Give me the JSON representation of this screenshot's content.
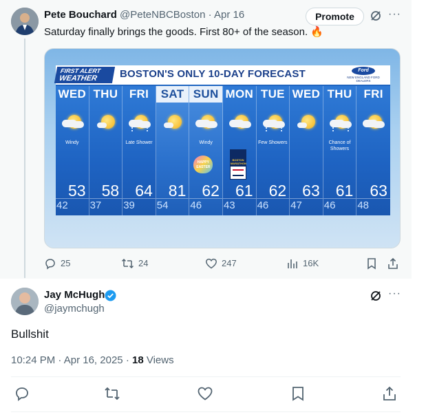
{
  "tweet1": {
    "name": "Pete Bouchard",
    "handle": "@PeteNBCBoston",
    "separator": "·",
    "date": "Apr 16",
    "promote_label": "Promote",
    "text": "Saturday finally brings the goods. First 80+ of the season.",
    "emoji": "🔥",
    "stats": {
      "replies": "25",
      "reposts": "24",
      "likes": "247",
      "views": "16K"
    }
  },
  "forecast": {
    "logo_line1": "FIRST ALERT",
    "logo_line2": "WEATHER",
    "title": "BOSTON'S ONLY 10-DAY FORECAST",
    "sponsor_logo": "Ford",
    "sponsor_text": "NEW ENGLAND FORD DEALERS",
    "days": [
      {
        "name": "WED",
        "icon": "partly-cloudy-icon",
        "condition": "Windy",
        "high": "53",
        "low": "42",
        "weekend": false
      },
      {
        "name": "THU",
        "icon": "mostly-sunny-icon",
        "condition": "",
        "high": "58",
        "low": "37",
        "weekend": false
      },
      {
        "name": "FRI",
        "icon": "showers-icon",
        "condition": "Late Shower",
        "high": "64",
        "low": "39",
        "weekend": false
      },
      {
        "name": "SAT",
        "icon": "mostly-sunny-icon",
        "condition": "",
        "high": "81",
        "low": "54",
        "weekend": true
      },
      {
        "name": "SUN",
        "icon": "partly-cloudy-icon",
        "condition": "Windy",
        "high": "62",
        "low": "46",
        "weekend": true
      },
      {
        "name": "MON",
        "icon": "partly-cloudy-icon",
        "condition": "",
        "high": "61",
        "low": "43",
        "weekend": false
      },
      {
        "name": "TUE",
        "icon": "showers-icon",
        "condition": "Few Showers",
        "high": "62",
        "low": "46",
        "weekend": false
      },
      {
        "name": "WED",
        "icon": "mostly-sunny-icon",
        "condition": "",
        "high": "63",
        "low": "47",
        "weekend": false
      },
      {
        "name": "THU",
        "icon": "showers-icon",
        "condition": "Chance of Showers",
        "high": "61",
        "low": "46",
        "weekend": false
      },
      {
        "name": "FRI",
        "icon": "partly-cloudy-icon",
        "condition": "",
        "high": "63",
        "low": "48",
        "weekend": false
      }
    ],
    "easter_badge": "HAPPY EASTER",
    "marathon_badge": "BOSTON MARATHON"
  },
  "tweet2": {
    "name": "Jay McHugh",
    "handle": "@jaymchugh",
    "text": "Bullshit",
    "time": "10:24 PM",
    "separator": "·",
    "date": "Apr 16, 2025",
    "separator2": "·",
    "views_count": "18",
    "views_label": "Views"
  },
  "colors": {
    "link_blue": "#1d9bf0",
    "text_primary": "#0f1419",
    "text_secondary": "#536471",
    "forecast_blue": "#1d64c0"
  }
}
